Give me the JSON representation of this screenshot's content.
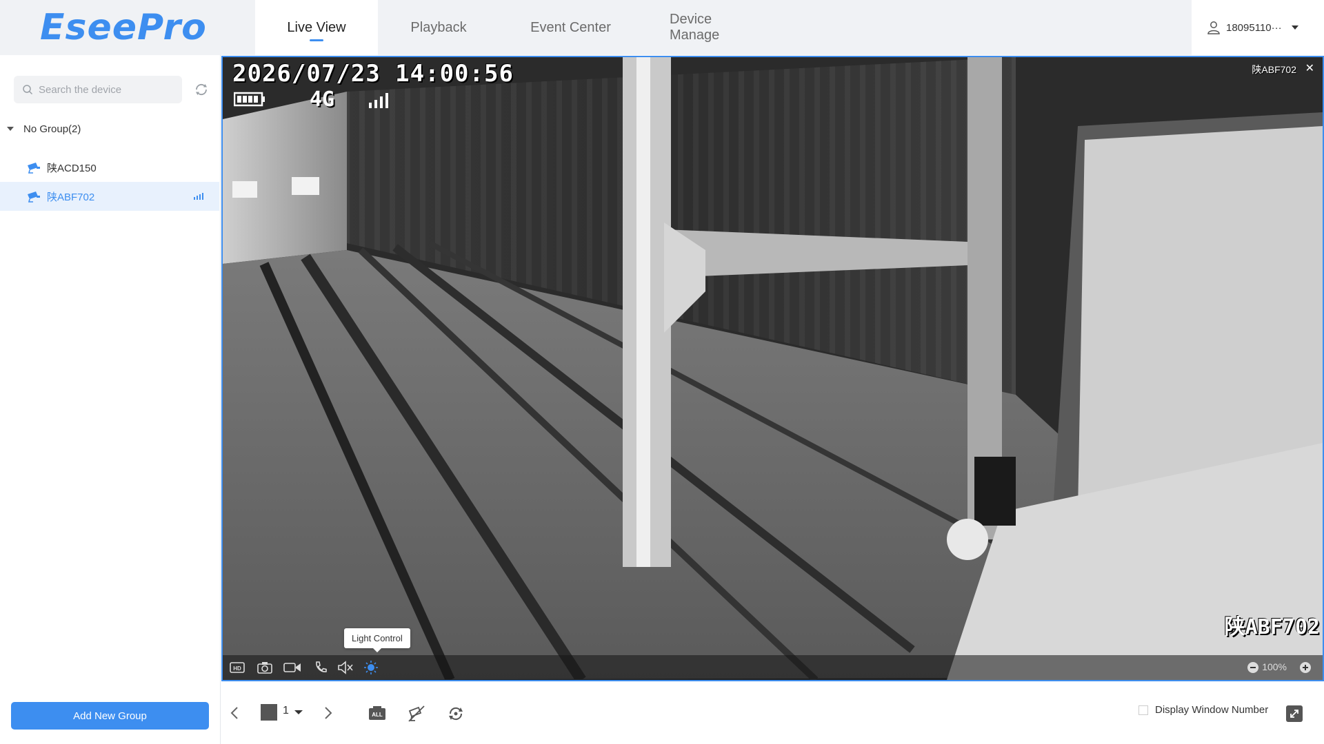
{
  "app": {
    "logo": "EseePro"
  },
  "nav": {
    "tabs": [
      {
        "label": "Live View",
        "active": true
      },
      {
        "label": "Playback"
      },
      {
        "label": "Event Center"
      },
      {
        "label": "Device Manage"
      }
    ]
  },
  "user": {
    "account": "18095110···",
    "icon": "user-icon"
  },
  "sidebar": {
    "search_placeholder": "Search the device",
    "group": {
      "label": "No Group(2)"
    },
    "devices": [
      {
        "name": "陕ACD150",
        "selected": false
      },
      {
        "name": "陕ABF702",
        "selected": true
      }
    ],
    "add_group_label": "Add New Group"
  },
  "video": {
    "window_title": "陕ABF702",
    "osd_datetime": "2026/07/23 14:00:56",
    "osd_network": "4G",
    "osd_plate": "陕ABF702",
    "zoom": "100%",
    "tooltip": "Light Control",
    "controls": [
      "hd-icon",
      "snapshot-icon",
      "record-icon",
      "talk-icon",
      "mute-icon",
      "light-icon"
    ]
  },
  "bottom": {
    "page": "1",
    "display_window_number_label": "Display Window Number"
  },
  "colors": {
    "accent": "#3d8ef0",
    "topbar_bg": "#f0f2f5",
    "selected_bg": "#e8f1fd"
  }
}
